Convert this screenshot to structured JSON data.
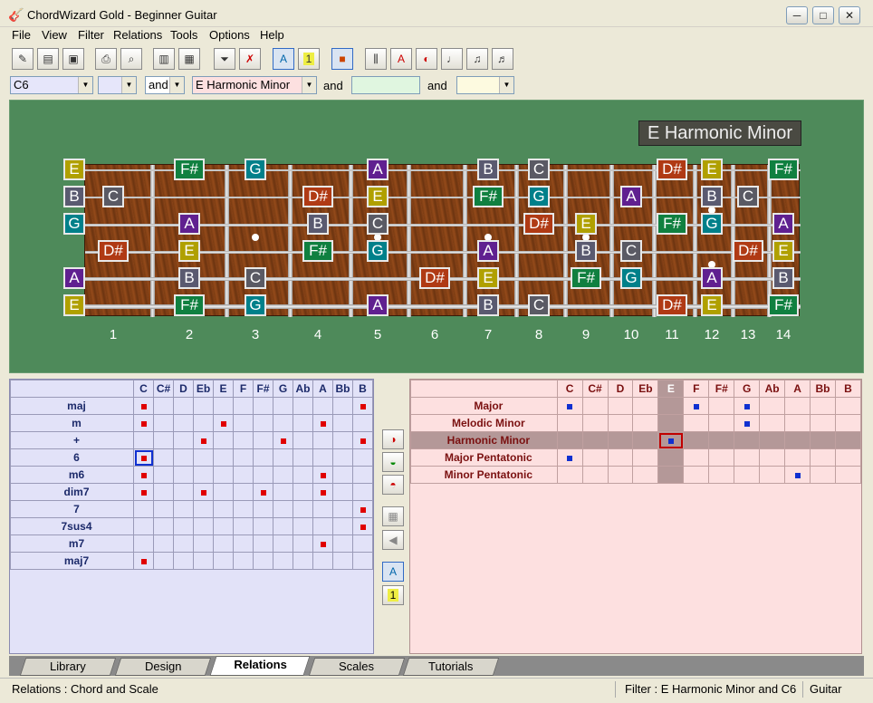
{
  "title": "ChordWizard Gold - Beginner Guitar",
  "icons": {
    "app": "guitar-icon",
    "minimize": "minimize-icon",
    "maximize": "maximize-icon",
    "close": "close-icon"
  },
  "menu": [
    "File",
    "View",
    "Filter",
    "Relations",
    "Tools",
    "Options",
    "Help"
  ],
  "toolbar_icons": [
    "edit-icon",
    "new-icon",
    "save-icon",
    "print-icon",
    "print-preview-icon",
    "book-icon",
    "layout-icon",
    "filter-icon",
    "clear-filter-icon",
    "note-name-icon",
    "interval-icon",
    "color-icon",
    "fretboard-icon",
    "staff-a-icon",
    "staff-b-icon",
    "staff-c-icon",
    "staff-d-icon",
    "staff-e-icon"
  ],
  "filter": {
    "chord": "C6",
    "chord2": "",
    "and1": "and",
    "scale": "E Harmonic Minor",
    "and2": "and",
    "field3": "",
    "and3": "and",
    "field4": ""
  },
  "colors": {
    "C": "#5a5a64",
    "C#": "#2e6a40",
    "D": "#2e6a40",
    "D#": "#b03a14",
    "E": "#b0a000",
    "F": "#2e6a40",
    "F#": "#108040",
    "G": "#00808a",
    "G#": "#602080",
    "A": "#602090",
    "A#": "#3a3a80",
    "B": "#5a5a70"
  },
  "fretboard": {
    "scale_title": "E Harmonic Minor",
    "fret_numbers": [
      "1",
      "2",
      "3",
      "4",
      "5",
      "6",
      "7",
      "8",
      "9",
      "10",
      "11",
      "12",
      "13",
      "14"
    ],
    "notes": [
      {
        "n": "E",
        "s": 0,
        "f": 0
      },
      {
        "n": "F#",
        "s": 0,
        "f": 2
      },
      {
        "n": "G",
        "s": 0,
        "f": 3
      },
      {
        "n": "A",
        "s": 0,
        "f": 5
      },
      {
        "n": "B",
        "s": 0,
        "f": 7
      },
      {
        "n": "C",
        "s": 0,
        "f": 8
      },
      {
        "n": "D#",
        "s": 0,
        "f": 11
      },
      {
        "n": "E",
        "s": 0,
        "f": 12
      },
      {
        "n": "F#",
        "s": 0,
        "f": 14
      },
      {
        "n": "B",
        "s": 1,
        "f": 0
      },
      {
        "n": "C",
        "s": 1,
        "f": 1
      },
      {
        "n": "D#",
        "s": 1,
        "f": 4
      },
      {
        "n": "E",
        "s": 1,
        "f": 5
      },
      {
        "n": "F#",
        "s": 1,
        "f": 7
      },
      {
        "n": "G",
        "s": 1,
        "f": 8
      },
      {
        "n": "A",
        "s": 1,
        "f": 10
      },
      {
        "n": "B",
        "s": 1,
        "f": 12
      },
      {
        "n": "C",
        "s": 1,
        "f": 13
      },
      {
        "n": "G",
        "s": 2,
        "f": 0
      },
      {
        "n": "A",
        "s": 2,
        "f": 2
      },
      {
        "n": "B",
        "s": 2,
        "f": 4
      },
      {
        "n": "C",
        "s": 2,
        "f": 5
      },
      {
        "n": "D#",
        "s": 2,
        "f": 8
      },
      {
        "n": "E",
        "s": 2,
        "f": 9
      },
      {
        "n": "F#",
        "s": 2,
        "f": 11
      },
      {
        "n": "G",
        "s": 2,
        "f": 12
      },
      {
        "n": "A",
        "s": 2,
        "f": 14
      },
      {
        "n": "D#",
        "s": 3,
        "f": 1
      },
      {
        "n": "E",
        "s": 3,
        "f": 2
      },
      {
        "n": "F#",
        "s": 3,
        "f": 4
      },
      {
        "n": "G",
        "s": 3,
        "f": 5
      },
      {
        "n": "A",
        "s": 3,
        "f": 7
      },
      {
        "n": "B",
        "s": 3,
        "f": 9
      },
      {
        "n": "C",
        "s": 3,
        "f": 10
      },
      {
        "n": "D#",
        "s": 3,
        "f": 13
      },
      {
        "n": "E",
        "s": 3,
        "f": 14
      },
      {
        "n": "A",
        "s": 4,
        "f": 0
      },
      {
        "n": "B",
        "s": 4,
        "f": 2
      },
      {
        "n": "C",
        "s": 4,
        "f": 3
      },
      {
        "n": "D#",
        "s": 4,
        "f": 6
      },
      {
        "n": "E",
        "s": 4,
        "f": 7
      },
      {
        "n": "F#",
        "s": 4,
        "f": 9
      },
      {
        "n": "G",
        "s": 4,
        "f": 10
      },
      {
        "n": "A",
        "s": 4,
        "f": 12
      },
      {
        "n": "B",
        "s": 4,
        "f": 14
      },
      {
        "n": "E",
        "s": 5,
        "f": 0
      },
      {
        "n": "F#",
        "s": 5,
        "f": 2
      },
      {
        "n": "G",
        "s": 5,
        "f": 3
      },
      {
        "n": "A",
        "s": 5,
        "f": 5
      },
      {
        "n": "B",
        "s": 5,
        "f": 7
      },
      {
        "n": "C",
        "s": 5,
        "f": 8
      },
      {
        "n": "D#",
        "s": 5,
        "f": 11
      },
      {
        "n": "E",
        "s": 5,
        "f": 12
      },
      {
        "n": "F#",
        "s": 5,
        "f": 14
      }
    ]
  },
  "chord_grid": {
    "columns": [
      "C",
      "C#",
      "D",
      "Eb",
      "E",
      "F",
      "F#",
      "G",
      "Ab",
      "A",
      "Bb",
      "B"
    ],
    "rows": [
      {
        "name": "maj",
        "marks": [
          0,
          11
        ]
      },
      {
        "name": "m",
        "marks": [
          0,
          4,
          9
        ]
      },
      {
        "name": "+",
        "marks": [
          3,
          7,
          11
        ]
      },
      {
        "name": "6",
        "marks": [
          0
        ],
        "selected": true
      },
      {
        "name": "m6",
        "marks": [
          0,
          9
        ]
      },
      {
        "name": "dim7",
        "marks": [
          0,
          3,
          6,
          9
        ]
      },
      {
        "name": "7",
        "marks": [
          11
        ]
      },
      {
        "name": "7sus4",
        "marks": [
          11
        ]
      },
      {
        "name": "m7",
        "marks": [
          9
        ]
      },
      {
        "name": "maj7",
        "marks": [
          0
        ]
      }
    ]
  },
  "scale_grid": {
    "columns": [
      "C",
      "C#",
      "D",
      "Eb",
      "E",
      "F",
      "F#",
      "G",
      "Ab",
      "A",
      "Bb",
      "B"
    ],
    "rows": [
      {
        "name": "Major",
        "marks": [
          0,
          5,
          7
        ]
      },
      {
        "name": "Melodic Minor",
        "marks": [
          7
        ]
      },
      {
        "name": "Harmonic Minor",
        "marks": [
          4
        ],
        "selected": true
      },
      {
        "name": "Major Pentatonic",
        "marks": [
          0
        ]
      },
      {
        "name": "Minor Pentatonic",
        "marks": [
          9
        ]
      }
    ]
  },
  "mid_icons": [
    "relation-up-icon",
    "relation-mid-icon",
    "relation-down-icon",
    "grid-icon",
    "speaker-icon",
    "note-name-icon",
    "interval-icon"
  ],
  "tabs": [
    "Library",
    "Design",
    "Relations",
    "Scales",
    "Tutorials"
  ],
  "active_tab": "Relations",
  "status": {
    "left": "Relations :  Chord and Scale",
    "filter": "Filter :  E Harmonic Minor and C6",
    "instrument": "Guitar"
  }
}
